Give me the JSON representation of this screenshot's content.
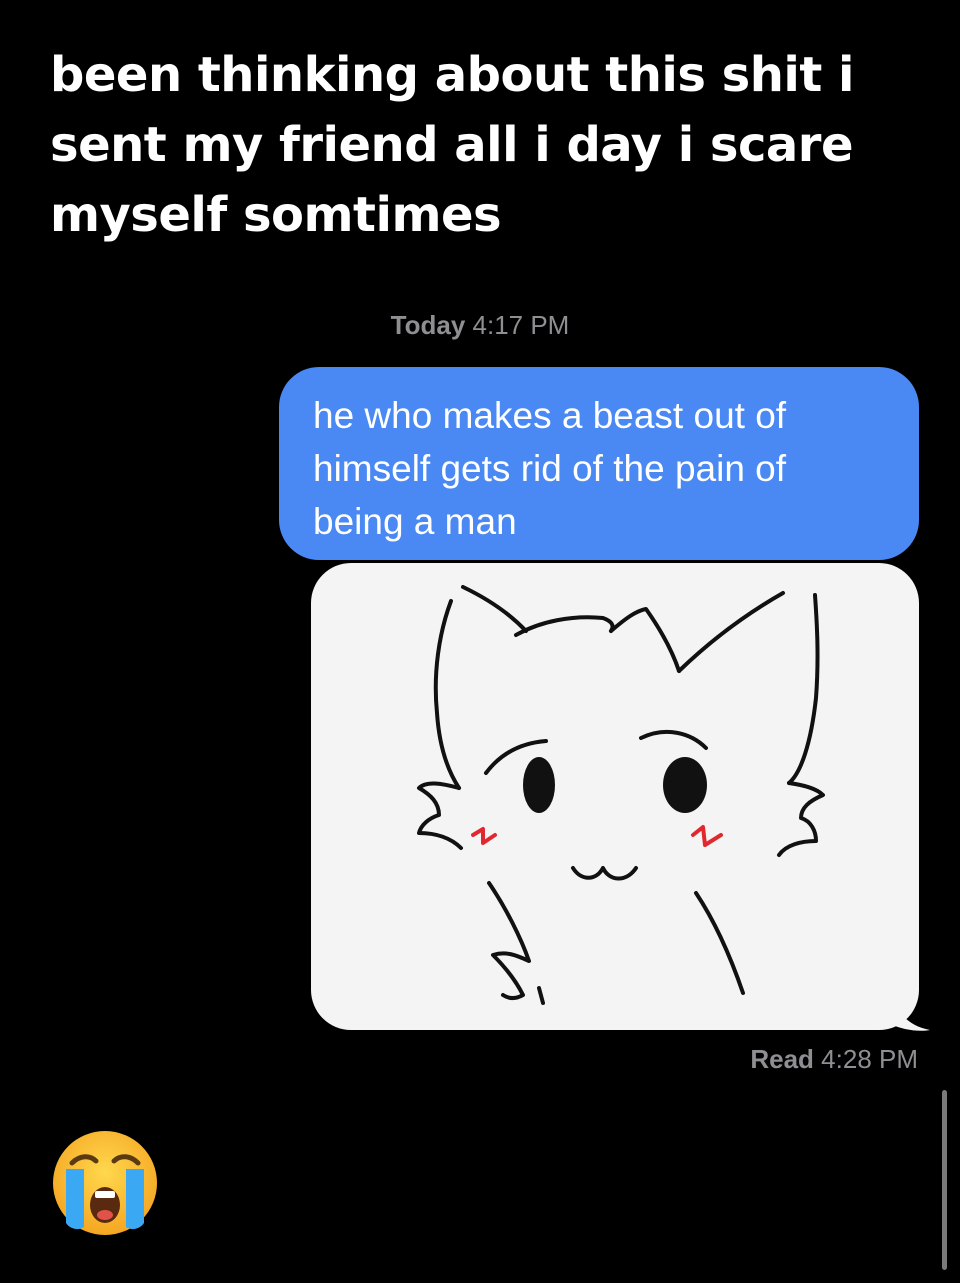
{
  "caption": "been thinking about this shit i sent my friend all i day i scare myself somtimes",
  "thread": {
    "timestamp_day": "Today",
    "timestamp_time": "4:17 PM",
    "messages": [
      {
        "text": "he who makes a beast out of himself gets rid of the pain of being a man"
      },
      {
        "image": "cat-drawing-icon"
      }
    ],
    "read_label": "Read",
    "read_time": "4:28 PM"
  },
  "reaction_emoji": "loudly-crying-face-icon",
  "colors": {
    "background": "#000000",
    "outgoing_bubble": "#4a89f3",
    "meta_text": "#8e8e93",
    "image_background": "#f4f4f4"
  }
}
